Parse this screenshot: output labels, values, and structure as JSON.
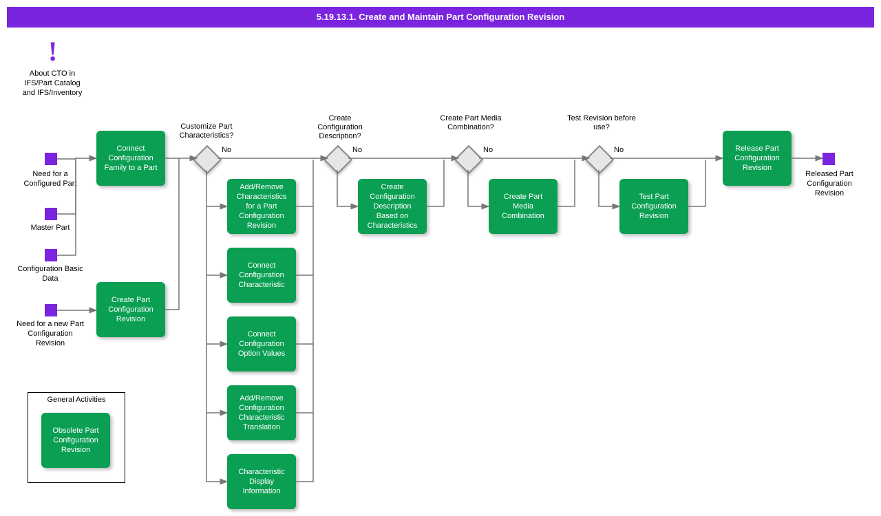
{
  "title": "5.19.13.1. Create and Maintain Part Configuration Revision",
  "note": {
    "mark": "!",
    "text": "About CTO in IFS/Part Catalog and IFS/Inventory"
  },
  "starts": {
    "needConfigured": "Need for a Configured Part",
    "masterPart": "Master Part",
    "configBasic": "Configuration Basic Data",
    "needNewRev": "Need for a new Part Configuration Revision"
  },
  "activities": {
    "connectFamily": "Connect Configuration Family to a Part",
    "createRev": "Create Part Configuration Revision",
    "addRemoveChar": "Add/Remove Characteristics for a Part Configuration Revision",
    "connectChar": "Connect Configuration Characteristic",
    "connectOptVal": "Connect Configuration Option Values",
    "addRemoveTrans": "Add/Remove Configuration Characteristic Translation",
    "charDisplay": "Characteristic Display Information",
    "createDesc": "Create Configuration Description Based on Characteristics",
    "createMedia": "Create Part Media Combination",
    "testRev": "Test Part Configuration Revision",
    "releaseRev": "Release Part Configuration Revision",
    "obsoleteRev": "Obsolete Part Configuration Revision"
  },
  "decisions": {
    "d1": {
      "q": "Customize Part Characteristics?",
      "no": "No"
    },
    "d2": {
      "q": "Create Configuration Description?",
      "no": "No"
    },
    "d3": {
      "q": "Create Part Media Combination?",
      "no": "No"
    },
    "d4": {
      "q": "Test Revision before use?",
      "no": "No"
    }
  },
  "general": {
    "title": "General Activities"
  },
  "end": "Released Part Configuration Revision",
  "colors": {
    "accent": "#7a24e0",
    "activity": "#0a9f53"
  }
}
